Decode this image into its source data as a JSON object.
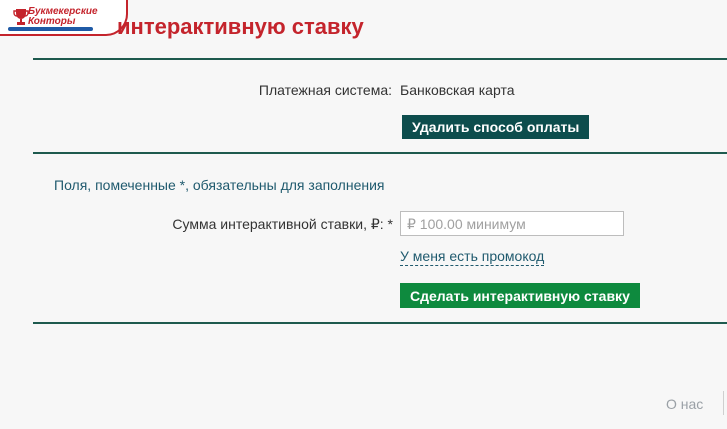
{
  "header": {
    "title": "интерактивную ставку",
    "logo": {
      "line1": "Букмекерские",
      "line2": "Конторы",
      "icon": "trophy-icon"
    }
  },
  "payment": {
    "system_label": "Платежная система:",
    "system_value": "Банковская карта",
    "remove_button": "Удалить способ оплаты"
  },
  "form": {
    "required_note": "Поля, помеченные *, обязательны для заполнения",
    "amount_label": "Сумма интерактивной ставки, ₽:",
    "amount_required_mark": "*",
    "amount_value": "",
    "amount_placeholder": "₽ 100.00 минимум",
    "promo_link": "У меня есть промокод",
    "submit_button": "Сделать интерактивную ставку"
  },
  "footer": {
    "about_link": "О нас"
  },
  "colors": {
    "title": "#c4242c",
    "rule": "#1e5a4e",
    "remove_button_bg": "#0d4d4d",
    "submit_button_bg": "#0e8a3e",
    "link": "#1f5a6e"
  }
}
